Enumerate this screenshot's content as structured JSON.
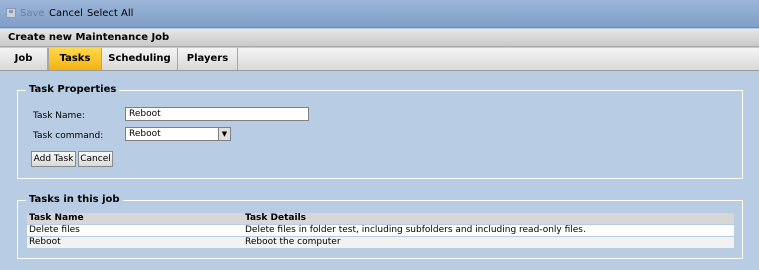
{
  "toolbar": {
    "save_label": "Save",
    "cancel_label": "Cancel",
    "select_all_label": "Select All",
    "save_icon": "save-icon"
  },
  "window": {
    "title": "Create new Maintenance Job"
  },
  "tabs": [
    {
      "label": "Job"
    },
    {
      "label": "Tasks"
    },
    {
      "label": "Scheduling"
    },
    {
      "label": "Players"
    }
  ],
  "task_properties": {
    "legend": "Task Properties",
    "name_label": "Task Name:",
    "name_value": "Reboot",
    "command_label": "Task command:",
    "command_value": "Reboot",
    "add_button": "Add Task",
    "cancel_button": "Cancel"
  },
  "tasks_in_job": {
    "legend": "Tasks in this job",
    "columns": [
      "Task Name",
      "Task Details"
    ],
    "rows": [
      {
        "name": "Delete files",
        "details": "Delete files in folder test, including subfolders and including read-only files."
      },
      {
        "name": "Reboot",
        "details": "Reboot the computer"
      }
    ]
  },
  "colors": {
    "active_tab": "#ffd84a",
    "background": "#b8cce4"
  }
}
